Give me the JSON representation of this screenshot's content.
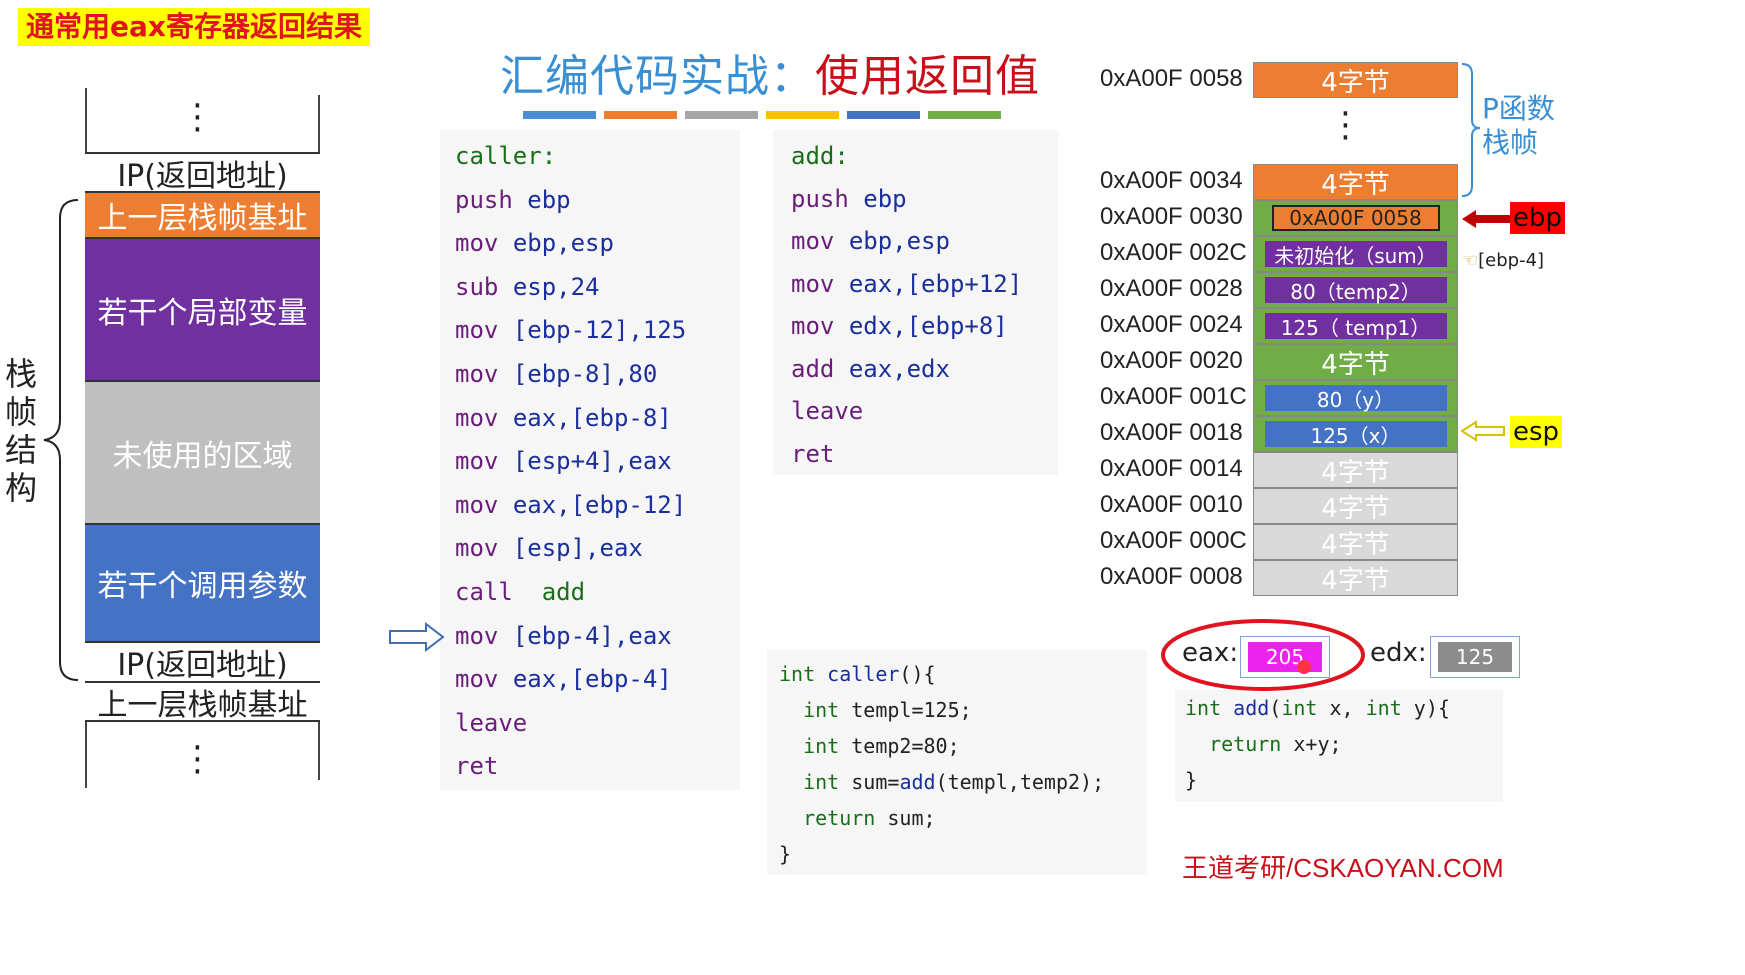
{
  "note": "通常用eax寄存器返回结果",
  "title": {
    "part1": "汇编代码实战：",
    "part2": "使用返回值"
  },
  "color_bars": [
    "#4a8fd6",
    "#ed7d31",
    "#a5a5a5",
    "#ffc000",
    "#4472c4",
    "#70ad47"
  ],
  "stack_diagram": {
    "side_label": "栈帧结构",
    "blocks": [
      {
        "label": "IP(返回地址)",
        "color": "#ffffff",
        "text_color": "#222222"
      },
      {
        "label": "上一层栈帧基址",
        "color": "#ed7d31",
        "text_color": "#ffffff"
      },
      {
        "label": "若干个局部变量",
        "color": "#7030a0",
        "text_color": "#ffffff"
      },
      {
        "label": "未使用的区域",
        "color": "#bfbfbf",
        "text_color": "#ffffff"
      },
      {
        "label": "若干个调用参数",
        "color": "#4472c4",
        "text_color": "#ffffff"
      },
      {
        "label": "IP(返回地址)",
        "color": "#ffffff",
        "text_color": "#222222"
      },
      {
        "label": "上一层栈帧基址",
        "color": "#ffffff",
        "text_color": "#222222"
      }
    ]
  },
  "caller_asm": [
    {
      "op": "caller:",
      "args": ""
    },
    {
      "op": "push",
      "args": "ebp"
    },
    {
      "op": "mov",
      "args": "ebp,esp"
    },
    {
      "op": "sub",
      "args": "esp,24"
    },
    {
      "op": "mov",
      "args": "[ebp-12],125"
    },
    {
      "op": "mov",
      "args": "[ebp-8],80"
    },
    {
      "op": "mov",
      "args": "eax,[ebp-8]"
    },
    {
      "op": "mov",
      "args": "[esp+4],eax"
    },
    {
      "op": "mov",
      "args": "eax,[ebp-12]"
    },
    {
      "op": "mov",
      "args": "[esp],eax"
    },
    {
      "op": "call",
      "args": "add"
    },
    {
      "op": "mov",
      "args": "[ebp-4],eax"
    },
    {
      "op": "mov",
      "args": "eax,[ebp-4]"
    },
    {
      "op": "leave",
      "args": ""
    },
    {
      "op": "ret",
      "args": ""
    }
  ],
  "add_asm": [
    {
      "op": "add:",
      "args": ""
    },
    {
      "op": "push",
      "args": "ebp"
    },
    {
      "op": "mov",
      "args": "ebp,esp"
    },
    {
      "op": "mov",
      "args": "eax,[ebp+12]"
    },
    {
      "op": "mov",
      "args": "edx,[ebp+8]"
    },
    {
      "op": "add",
      "args": "eax,edx"
    },
    {
      "op": "leave",
      "args": ""
    },
    {
      "op": "ret",
      "args": ""
    }
  ],
  "caller_c": [
    "int caller(){",
    "  int templ=125;",
    "  int temp2=80;",
    "  int sum=add(templ,temp2);",
    "  return sum;",
    "}"
  ],
  "add_c": [
    "int add(int x, int y){",
    "  return x+y;",
    "}"
  ],
  "memory": {
    "addresses": [
      "0xA00F 0058",
      "0xA00F 0034",
      "0xA00F 0030",
      "0xA00F 002C",
      "0xA00F 0028",
      "0xA00F 0024",
      "0xA00F 0020",
      "0xA00F 001C",
      "0xA00F 0018",
      "0xA00F 0014",
      "0xA00F 0010",
      "0xA00F 000C",
      "0xA00F 0008"
    ],
    "cells": [
      {
        "text": "4字节",
        "bg": "#ed7d31",
        "inner": ""
      },
      {
        "text": "4字节",
        "bg": "#ed7d31",
        "inner": ""
      },
      {
        "text": "0xA00F 0058",
        "bg": "#70ad47",
        "inner": "#ed7d31"
      },
      {
        "text": "未初始化（sum）",
        "bg": "#70ad47",
        "inner": "#7030a0"
      },
      {
        "text": "80（temp2）",
        "bg": "#70ad47",
        "inner": "#7030a0"
      },
      {
        "text": "125（ temp1）",
        "bg": "#70ad47",
        "inner": "#7030a0"
      },
      {
        "text": "4字节",
        "bg": "#70ad47",
        "inner": ""
      },
      {
        "text": "80（y）",
        "bg": "#70ad47",
        "inner": "#4472c4"
      },
      {
        "text": "125（x）",
        "bg": "#70ad47",
        "inner": "#4472c4"
      },
      {
        "text": "4字节",
        "bg": "#d9d9d9",
        "inner": ""
      },
      {
        "text": "4字节",
        "bg": "#d9d9d9",
        "inner": ""
      },
      {
        "text": "4字节",
        "bg": "#d9d9d9",
        "inner": ""
      },
      {
        "text": "4字节",
        "bg": "#d9d9d9",
        "inner": ""
      }
    ],
    "frame_label": "P函数栈帧",
    "ebp_label": "ebp",
    "esp_label": "esp",
    "ebp_minus4_label": "[ebp-4]"
  },
  "registers": {
    "eax_label": "eax:",
    "eax_value": "205",
    "edx_label": "edx:",
    "edx_value": "125"
  },
  "footer": "王道考研/CSKAOYAN.COM"
}
